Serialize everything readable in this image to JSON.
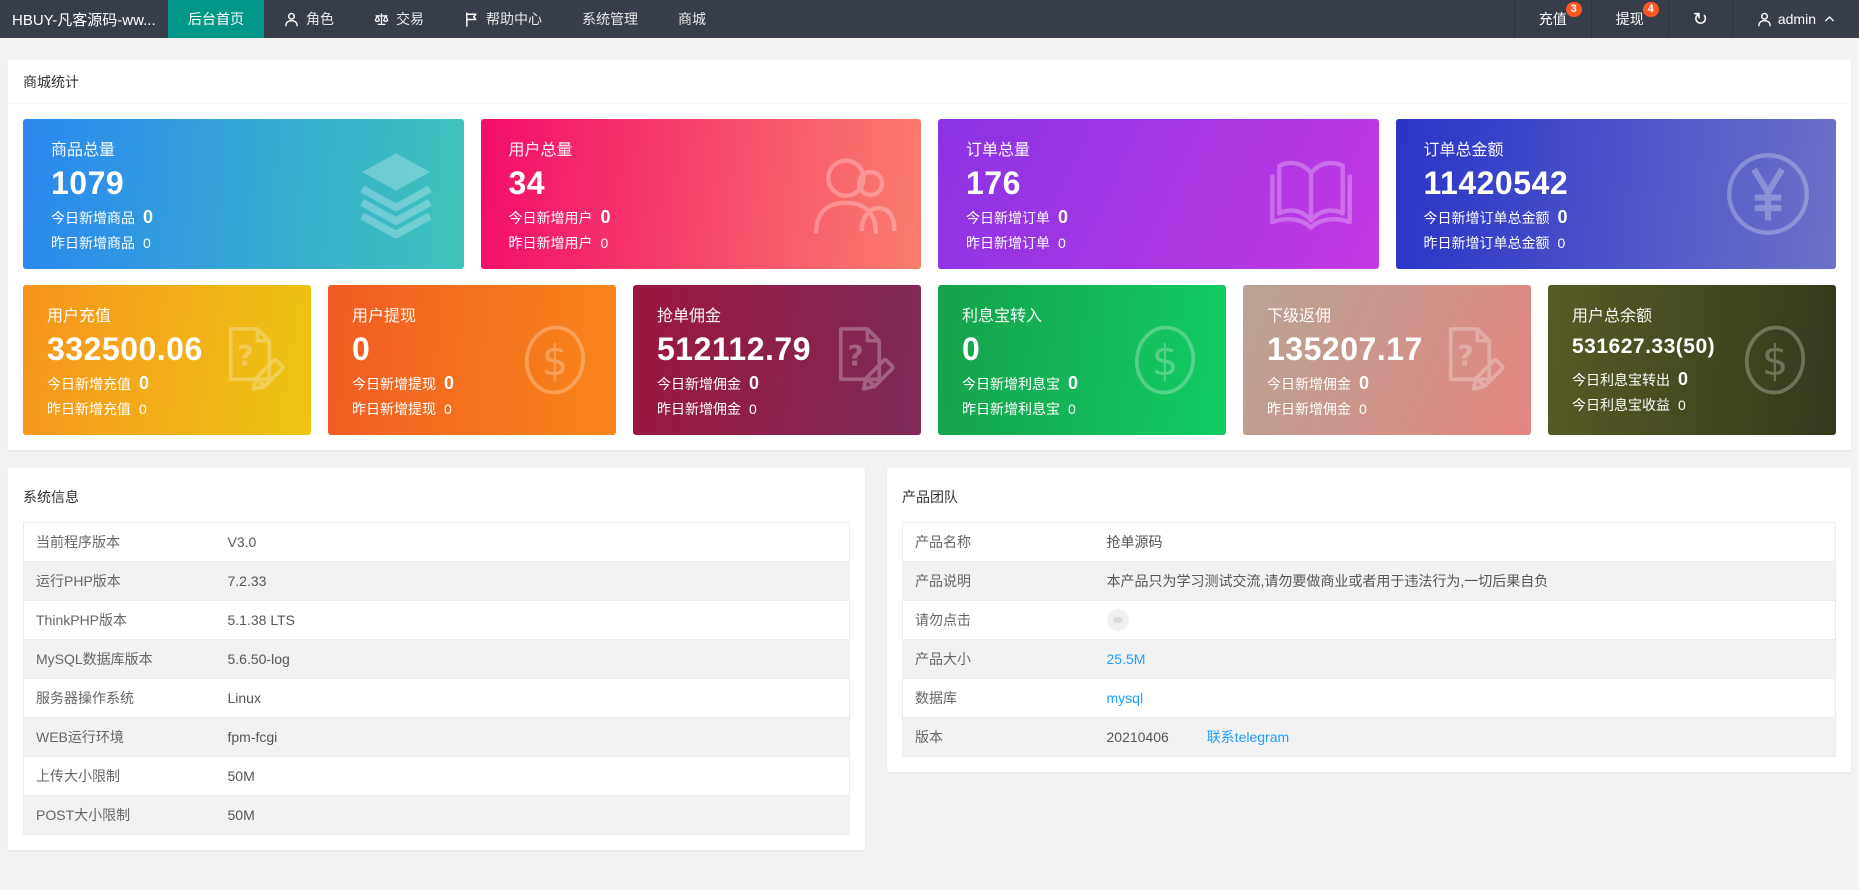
{
  "navbar": {
    "brand": "HBUY-凡客源码-ww...",
    "menu": [
      {
        "label": "后台首页",
        "active": true
      },
      {
        "label": "角色",
        "icon": "person-icon"
      },
      {
        "label": "交易",
        "icon": "scales-icon"
      },
      {
        "label": "帮助中心",
        "icon": "flag-icon"
      },
      {
        "label": "系统管理"
      },
      {
        "label": "商城"
      }
    ],
    "recharge": {
      "label": "充值",
      "badge": "3"
    },
    "withdraw": {
      "label": "提现",
      "badge": "4"
    },
    "refresh_icon": "↻",
    "user": {
      "name": "admin"
    }
  },
  "stats": {
    "title": "商城统计",
    "cards": [
      {
        "title": "商品总量",
        "value": "1079",
        "today_label": "今日新增商品",
        "today_value": "0",
        "yesterday_label": "昨日新增商品",
        "yesterday_value": "0",
        "icon": "layers-icon",
        "gradient": [
          "#2b87f0",
          "#3fc4ba"
        ]
      },
      {
        "title": "用户总量",
        "value": "34",
        "today_label": "今日新增用户",
        "today_value": "0",
        "yesterday_label": "昨日新增用户",
        "yesterday_value": "0",
        "icon": "users-icon",
        "gradient": [
          "#f20d6b",
          "#fb7e6c"
        ]
      },
      {
        "title": "订单总量",
        "value": "176",
        "today_label": "今日新增订单",
        "today_value": "0",
        "yesterday_label": "昨日新增订单",
        "yesterday_value": "0",
        "icon": "book-icon",
        "gradient": [
          "#8a33e4",
          "#c339e1"
        ]
      },
      {
        "title": "订单总金额",
        "value": "11420542",
        "today_label": "今日新增订单总金额",
        "today_value": "0",
        "yesterday_label": "昨日新增订单总金额",
        "yesterday_value": "0",
        "icon": "yen-circle-icon",
        "gradient": [
          "#2a34c8",
          "#6d71c8"
        ]
      },
      {
        "title": "用户充值",
        "value": "332500.06",
        "today_label": "今日新增充值",
        "today_value": "0",
        "yesterday_label": "昨日新增充值",
        "yesterday_value": "0",
        "icon": "doc-question-icon",
        "gradient": [
          "#f7941d",
          "#edc614"
        ]
      },
      {
        "title": "用户提现",
        "value": "0",
        "today_label": "今日新增提现",
        "today_value": "0",
        "yesterday_label": "昨日新增提现",
        "yesterday_value": "0",
        "icon": "dollar-circle-icon",
        "gradient": [
          "#f15b22",
          "#f8871a"
        ]
      },
      {
        "title": "抢单佣金",
        "value": "512112.79",
        "today_label": "今日新增佣金",
        "today_value": "0",
        "yesterday_label": "昨日新增佣金",
        "yesterday_value": "0",
        "icon": "doc-question-icon",
        "gradient": [
          "#9a173f",
          "#7d2a57"
        ]
      },
      {
        "title": "利息宝转入",
        "value": "0",
        "today_label": "今日新增利息宝",
        "today_value": "0",
        "yesterday_label": "昨日新增利息宝",
        "yesterday_value": "0",
        "icon": "dollar-circle-icon",
        "gradient": [
          "#16a24b",
          "#10cc63"
        ]
      },
      {
        "title": "下级返佣",
        "value": "135207.17",
        "today_label": "今日新增佣金",
        "today_value": "0",
        "yesterday_label": "昨日新增佣金",
        "yesterday_value": "0",
        "icon": "doc-question-icon",
        "gradient": [
          "#b7a496",
          "#e58480"
        ]
      },
      {
        "title": "用户总余额",
        "value": "531627.33(50)",
        "today_label": "今日利息宝转出",
        "today_value": "0",
        "yesterday_label": "今日利息宝收益",
        "yesterday_value": "0",
        "icon": "dollar-circle-icon",
        "gradient": [
          "#575b25",
          "#33391d"
        ]
      }
    ]
  },
  "system_info": {
    "title": "系统信息",
    "rows": [
      {
        "label": "当前程序版本",
        "value": "V3.0"
      },
      {
        "label": "运行PHP版本",
        "value": "7.2.33"
      },
      {
        "label": "ThinkPHP版本",
        "value": "5.1.38 LTS"
      },
      {
        "label": "MySQL数据库版本",
        "value": "5.6.50-log"
      },
      {
        "label": "服务器操作系统",
        "value": "Linux"
      },
      {
        "label": "WEB运行环境",
        "value": "fpm-fcgi"
      },
      {
        "label": "上传大小限制",
        "value": "50M"
      },
      {
        "label": "POST大小限制",
        "value": "50M"
      }
    ]
  },
  "product_team": {
    "title": "产品团队",
    "rows": [
      {
        "label": "产品名称",
        "value": "抢单源码"
      },
      {
        "label": "产品说明",
        "value": "本产品只为学习测试交流,请勿要做商业或者用于违法行为,一切后果自负"
      },
      {
        "label": "请勿点击",
        "value": ""
      },
      {
        "label": "产品大小",
        "value": "25.5M"
      },
      {
        "label": "数据库",
        "value": "mysql"
      },
      {
        "label": "版本",
        "value": "20210406",
        "link": "联系telegram"
      }
    ]
  },
  "colors": {
    "navbar_bg": "#373d49",
    "active_tab": "#009688",
    "badge": "#ff5722",
    "link": "#1e9fff",
    "page_bg": "#f2f2f2"
  }
}
